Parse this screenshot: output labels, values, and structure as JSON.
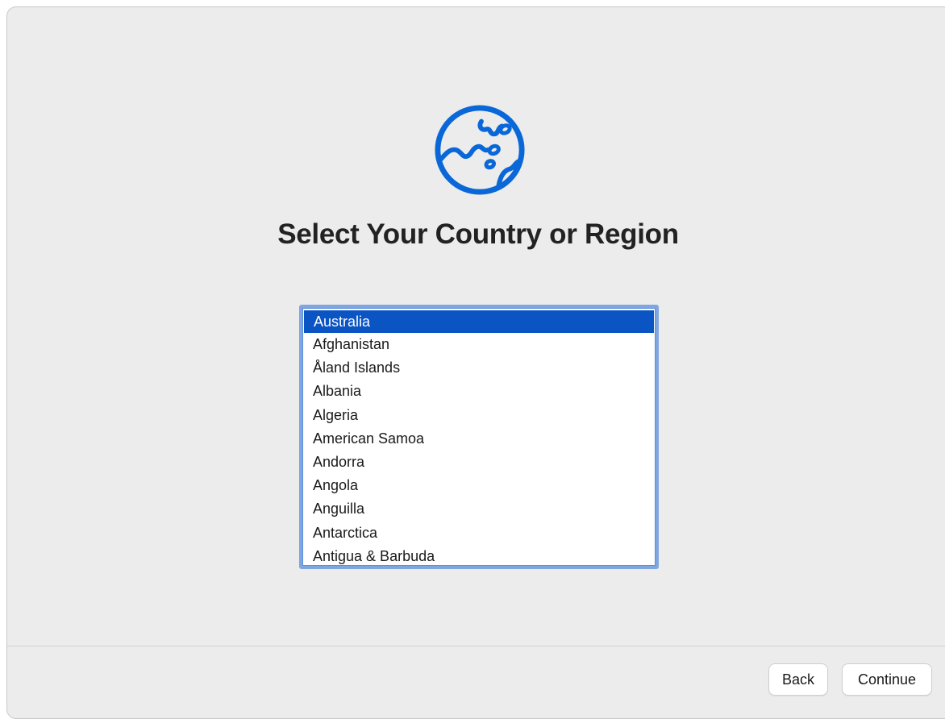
{
  "page": {
    "title": "Select Your Country or Region"
  },
  "icon": {
    "name": "globe-icon",
    "color": "#0a67d8"
  },
  "country_list": {
    "selected": "Australia",
    "items": [
      "Australia",
      "Afghanistan",
      "Åland Islands",
      "Albania",
      "Algeria",
      "American Samoa",
      "Andorra",
      "Angola",
      "Anguilla",
      "Antarctica",
      "Antigua & Barbuda"
    ]
  },
  "footer": {
    "back_label": "Back",
    "continue_label": "Continue"
  },
  "colors": {
    "selection": "#0a54c3",
    "focus_ring": "#7fa6e0",
    "background": "#ececec"
  }
}
